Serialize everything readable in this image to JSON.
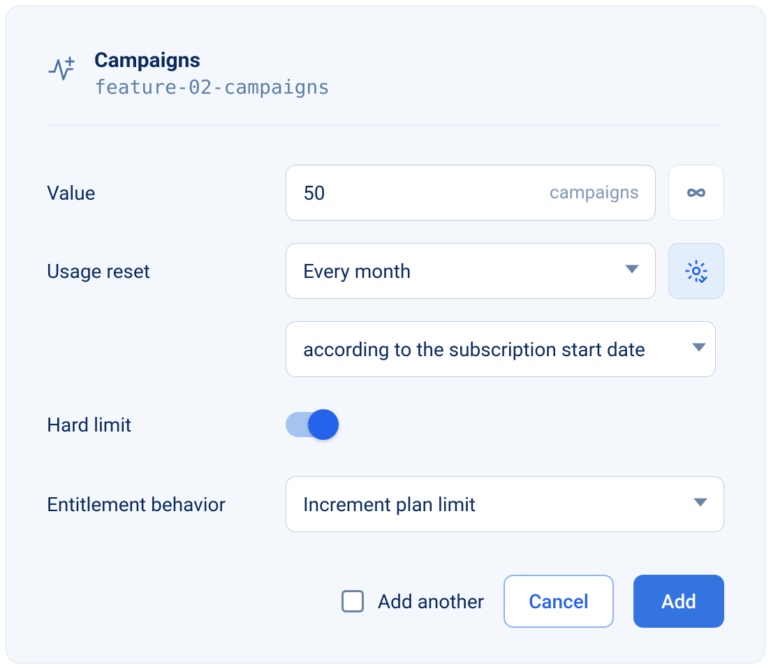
{
  "header": {
    "title": "Campaigns",
    "subtitle": "feature-02-campaigns"
  },
  "fields": {
    "value": {
      "label": "Value",
      "value": "50",
      "unit": "campaigns"
    },
    "usage_reset": {
      "label": "Usage reset",
      "selected": "Every month",
      "sub_selected": "according to the subscription start date"
    },
    "hard_limit": {
      "label": "Hard limit",
      "enabled": true
    },
    "entitlement_behavior": {
      "label": "Entitlement behavior",
      "selected": "Increment plan limit"
    }
  },
  "footer": {
    "add_another_label": "Add another",
    "cancel_label": "Cancel",
    "add_label": "Add"
  }
}
